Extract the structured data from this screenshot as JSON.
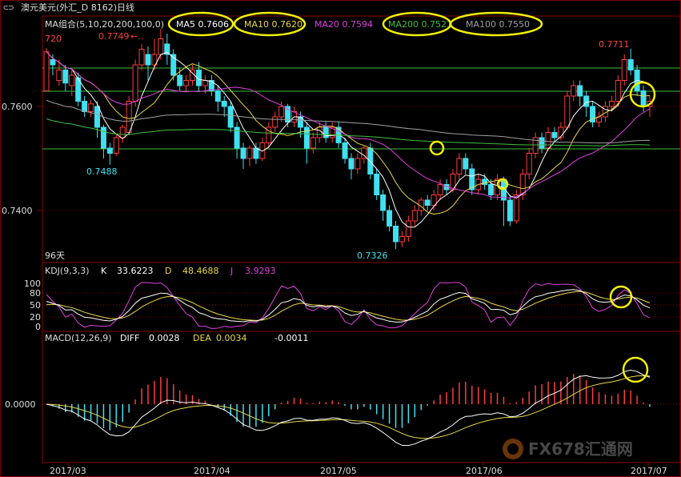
{
  "header": {
    "title": "澳元美元(外汇_D 8162)日线",
    "ma_group": "MA组合(5,10,20,200,100,0)",
    "ma5": "MA5 0.7606",
    "ma10": "MA10 0.7620",
    "ma20": "MA20 0.7594",
    "ma200": "MA200 0.7521",
    "ma100": "MA100 0.7550"
  },
  "price_panel": {
    "top_label": "720",
    "y_ticks": [
      "0.7600",
      "0.7400"
    ],
    "annotations": {
      "high1": "0.7749",
      "low1": "0.7488",
      "low2": "0.7326",
      "high2": "0.7711"
    },
    "period_label": "96天"
  },
  "kdj_panel": {
    "title": "KDJ(9,3,3)",
    "k_label": "K",
    "k_value": "33.6223",
    "d_label": "D",
    "d_value": "48.4688",
    "j_label": "J",
    "j_value": "3.9293",
    "y_ticks": [
      "100",
      "80",
      "50",
      "20",
      "0"
    ]
  },
  "macd_panel": {
    "title": "MACD(12,26,9)",
    "diff_label": "DIFF",
    "diff_value": "0.0028",
    "dea_label": "DEA",
    "dea_value": "0.0034",
    "macd_value": "-0.0011",
    "y_tick": "0.0000"
  },
  "x_axis": [
    "2017/03",
    "2017/04",
    "2017/05",
    "2017/06",
    "2017/07"
  ],
  "watermark": "FX678汇通网",
  "colors": {
    "up": "#ff3c3c",
    "down": "#40e0f0",
    "ma5": "#ffffff",
    "ma10": "#e8d84a",
    "ma20": "#e040e0",
    "ma200": "#40c040",
    "ma100": "#a0a0a0",
    "highlight": "#f0f000"
  },
  "chart_data": {
    "type": "candlestick",
    "x_range": [
      "2017/03",
      "2017/07"
    ],
    "price_range": [
      0.73,
      0.776
    ],
    "candles": [
      [
        0.763,
        0.7705,
        0.765,
        0.7712
      ],
      [
        0.769,
        0.768,
        0.766,
        0.77
      ],
      [
        0.765,
        0.767,
        0.764,
        0.769
      ],
      [
        0.767,
        0.7645,
        0.763,
        0.768
      ],
      [
        0.764,
        0.766,
        0.762,
        0.767
      ],
      [
        0.7655,
        0.761,
        0.76,
        0.7665
      ],
      [
        0.761,
        0.759,
        0.758,
        0.762
      ],
      [
        0.759,
        0.7605,
        0.758,
        0.7612
      ],
      [
        0.76,
        0.756,
        0.754,
        0.761
      ],
      [
        0.756,
        0.752,
        0.75,
        0.7565
      ],
      [
        0.752,
        0.751,
        0.7488,
        0.753
      ],
      [
        0.751,
        0.754,
        0.7505,
        0.7545
      ],
      [
        0.754,
        0.756,
        0.753,
        0.7565
      ],
      [
        0.755,
        0.761,
        0.7545,
        0.762
      ],
      [
        0.761,
        0.768,
        0.76,
        0.769
      ],
      [
        0.768,
        0.771,
        0.767,
        0.772
      ],
      [
        0.77,
        0.768,
        0.765,
        0.7715
      ],
      [
        0.768,
        0.77,
        0.767,
        0.773
      ],
      [
        0.77,
        0.773,
        0.769,
        0.7749
      ],
      [
        0.772,
        0.77,
        0.768,
        0.774
      ],
      [
        0.77,
        0.766,
        0.765,
        0.771
      ],
      [
        0.766,
        0.764,
        0.763,
        0.7675
      ],
      [
        0.764,
        0.765,
        0.763,
        0.766
      ],
      [
        0.765,
        0.767,
        0.764,
        0.768
      ],
      [
        0.767,
        0.764,
        0.763,
        0.7685
      ],
      [
        0.764,
        0.765,
        0.7625,
        0.766
      ],
      [
        0.765,
        0.763,
        0.762,
        0.766
      ],
      [
        0.763,
        0.761,
        0.759,
        0.764
      ],
      [
        0.761,
        0.76,
        0.758,
        0.762
      ],
      [
        0.76,
        0.756,
        0.755,
        0.761
      ],
      [
        0.756,
        0.752,
        0.75,
        0.757
      ],
      [
        0.752,
        0.75,
        0.748,
        0.753
      ],
      [
        0.75,
        0.752,
        0.7485,
        0.7525
      ],
      [
        0.752,
        0.75,
        0.749,
        0.753
      ],
      [
        0.75,
        0.753,
        0.7495,
        0.754
      ],
      [
        0.753,
        0.756,
        0.752,
        0.757
      ],
      [
        0.756,
        0.758,
        0.755,
        0.759
      ],
      [
        0.758,
        0.76,
        0.757,
        0.761
      ],
      [
        0.76,
        0.757,
        0.756,
        0.7605
      ],
      [
        0.757,
        0.759,
        0.756,
        0.76
      ],
      [
        0.758,
        0.756,
        0.754,
        0.759
      ],
      [
        0.756,
        0.752,
        0.749,
        0.757
      ],
      [
        0.752,
        0.754,
        0.751,
        0.755
      ],
      [
        0.754,
        0.756,
        0.753,
        0.757
      ],
      [
        0.756,
        0.754,
        0.753,
        0.757
      ],
      [
        0.754,
        0.756,
        0.753,
        0.757
      ],
      [
        0.756,
        0.753,
        0.752,
        0.757
      ],
      [
        0.753,
        0.75,
        0.749,
        0.754
      ],
      [
        0.75,
        0.748,
        0.746,
        0.751
      ],
      [
        0.748,
        0.75,
        0.747,
        0.751
      ],
      [
        0.75,
        0.752,
        0.749,
        0.7525
      ],
      [
        0.752,
        0.747,
        0.746,
        0.753
      ],
      [
        0.747,
        0.743,
        0.742,
        0.748
      ],
      [
        0.743,
        0.74,
        0.738,
        0.744
      ],
      [
        0.74,
        0.737,
        0.736,
        0.741
      ],
      [
        0.737,
        0.734,
        0.7326,
        0.738
      ],
      [
        0.734,
        0.735,
        0.733,
        0.736
      ],
      [
        0.735,
        0.738,
        0.734,
        0.739
      ],
      [
        0.738,
        0.74,
        0.737,
        0.741
      ],
      [
        0.74,
        0.742,
        0.739,
        0.7425
      ],
      [
        0.742,
        0.741,
        0.74,
        0.743
      ],
      [
        0.741,
        0.743,
        0.74,
        0.744
      ],
      [
        0.743,
        0.745,
        0.742,
        0.746
      ],
      [
        0.745,
        0.744,
        0.743,
        0.746
      ],
      [
        0.744,
        0.747,
        0.7435,
        0.748
      ],
      [
        0.747,
        0.75,
        0.746,
        0.751
      ],
      [
        0.75,
        0.748,
        0.747,
        0.751
      ],
      [
        0.748,
        0.744,
        0.743,
        0.749
      ],
      [
        0.744,
        0.746,
        0.743,
        0.747
      ],
      [
        0.746,
        0.745,
        0.744,
        0.747
      ],
      [
        0.745,
        0.743,
        0.742,
        0.746
      ],
      [
        0.743,
        0.746,
        0.742,
        0.747
      ],
      [
        0.746,
        0.742,
        0.737,
        0.7465
      ],
      [
        0.742,
        0.738,
        0.737,
        0.743
      ],
      [
        0.738,
        0.743,
        0.7375,
        0.744
      ],
      [
        0.743,
        0.747,
        0.742,
        0.748
      ],
      [
        0.747,
        0.751,
        0.746,
        0.752
      ],
      [
        0.751,
        0.754,
        0.75,
        0.755
      ],
      [
        0.754,
        0.752,
        0.751,
        0.755
      ],
      [
        0.752,
        0.755,
        0.7515,
        0.756
      ],
      [
        0.755,
        0.754,
        0.753,
        0.756
      ],
      [
        0.754,
        0.756,
        0.7535,
        0.757
      ],
      [
        0.756,
        0.762,
        0.7555,
        0.763
      ],
      [
        0.762,
        0.764,
        0.761,
        0.765
      ],
      [
        0.764,
        0.762,
        0.76,
        0.765
      ],
      [
        0.762,
        0.76,
        0.758,
        0.763
      ],
      [
        0.76,
        0.757,
        0.756,
        0.761
      ],
      [
        0.757,
        0.758,
        0.756,
        0.759
      ],
      [
        0.758,
        0.76,
        0.757,
        0.761
      ],
      [
        0.76,
        0.761,
        0.759,
        0.762
      ],
      [
        0.761,
        0.765,
        0.76,
        0.766
      ],
      [
        0.765,
        0.769,
        0.764,
        0.77
      ],
      [
        0.769,
        0.767,
        0.766,
        0.7711
      ],
      [
        0.767,
        0.763,
        0.762,
        0.768
      ],
      [
        0.763,
        0.76,
        0.759,
        0.764
      ],
      [
        0.76,
        0.761,
        0.758,
        0.762
      ]
    ]
  }
}
